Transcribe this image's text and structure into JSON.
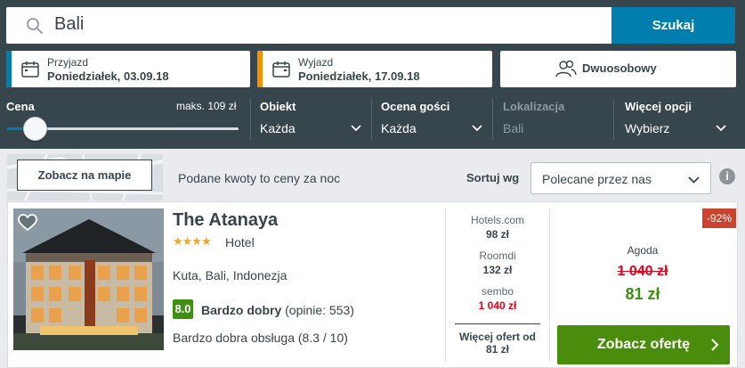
{
  "search": {
    "query": "Bali",
    "button_label": "Szukaj",
    "icon": "search-icon"
  },
  "dates": {
    "checkin_label": "Przyjazd",
    "checkin_value": "Poniedziałek, 03.09.18",
    "checkout_label": "Wyjazd",
    "checkout_value": "Poniedziałek, 17.09.18",
    "checkin_color": "#007faf",
    "checkout_color": "#f39200"
  },
  "room": {
    "label": "Dwuosobowy",
    "icon": "people-icon"
  },
  "filters": {
    "price_title": "Cena",
    "price_max": "maks. 109 zł",
    "price_slider_fraction": 0.04,
    "property_title": "Obiekt",
    "property_value": "Każda",
    "rating_title": "Ocena gości",
    "rating_value": "Każda",
    "location_title": "Lokalizacja",
    "location_value": "Bali",
    "more_title": "Więcej opcji",
    "more_value": "Wybierz"
  },
  "toolbar": {
    "map_button": "Zobacz na mapie",
    "price_note": "Podane kwoty to ceny za noc",
    "sort_label": "Sortuj wg",
    "sort_value": "Polecane przez nas",
    "info_icon": "i"
  },
  "hotel": {
    "name": "The Atanaya",
    "stars": "★★★★",
    "star_count": 4,
    "type": "Hotel",
    "location": "Kuta, Bali, Indonezja",
    "rating_score": "8.0",
    "rating_label": "Bardzo dobry",
    "rating_count": " (opinie: 553)",
    "rating_color": "#3f8f12",
    "sub_rating": "Bardzo dobra obsługa (8.3 / 10)",
    "offers": [
      {
        "provider": "Hotels.com",
        "price": "98 zł"
      },
      {
        "provider": "Roomdi",
        "price": "132 zł"
      },
      {
        "provider": "sembo",
        "price": "1 040 zł"
      }
    ],
    "more_offers_line1": "Więcej ofert od",
    "more_offers_line2": "81 zł",
    "discount": "-92%",
    "best_site": "Agoda",
    "old_price": "1 040 zł",
    "new_price": "81 zł",
    "deal_button": "Zobacz ofertę"
  }
}
